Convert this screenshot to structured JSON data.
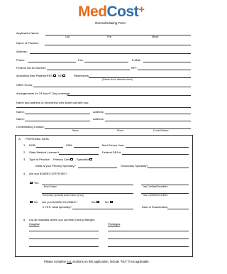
{
  "header": {
    "logo_med": "Med",
    "logo_cost": "Cost",
    "logo_plus": "+",
    "subtitle": "Recredentialing Form"
  },
  "top": {
    "applicant_name": "Applicant's Name:",
    "last": "Last",
    "first": "First",
    "middle": "Middle",
    "name_of_practice": "Name of Practice:",
    "address": "Address:",
    "phone": "Phone:",
    "fax": "Fax:",
    "email": "E-Mail:",
    "federal_tax_id": "Federal Tax ID Number:",
    "npi": "NPI:",
    "accepting": "Accepting New Patients?",
    "yes": "YES",
    "no": "NO",
    "restrictions": "Restrictions:",
    "restrictions_note": "(Please list on attached sheet)",
    "office_hours": "Office Hours:",
    "arrangements": "Arrangements for 24-hour/7 Day coverage:",
    "share_call": "Name and address or provider(s) who share call with you:",
    "name1": "Name:",
    "address1": "Address:",
    "name2": "Name:",
    "address2": "Address:",
    "credentialing_contact": "Credentialing Contact:",
    "contact_name": "Name",
    "contact_phone": "Phone",
    "contact_email": "E-mail Address"
  },
  "section_a": {
    "letter": "A.",
    "title": "PERSONAL DATA",
    "i1": "1.",
    "dob": "DOB:",
    "ssn": "SSN:",
    "med_school_year": "Med School Year:",
    "i2": "2.",
    "state_license": "State Medical License #:",
    "federal_dea": "Federal DEA #:",
    "i3": "3.",
    "type_of_practice": "Type of Practice:",
    "primary_care": "Primary Care",
    "specialist": "Specialist",
    "primary_specialty": "What is your Primary Specialty?",
    "secondary_specialty": "Secondary Specialty?",
    "i4": "4.",
    "board_certified": "Are you BOARD CERTIFIED?",
    "yes": "Yes",
    "board_name": "Board Name",
    "year_certified": "Year Certified/Recertified",
    "secondary_board": "Secondary Specialty Board Name (if any)",
    "year_certified2": "Year Certified/Recertified",
    "no": "No",
    "board_eligible": "Are you BOARD ELIGIBLE?",
    "yes2": "Yes",
    "no2": "No",
    "if_so": "If YES, what specialty?",
    "date_exam": "Date of Examination:",
    "i5": "5.",
    "list_hospitals": "List all hospitals where you currently have privileges:",
    "hospital": "Hospital",
    "privileges": "Privileges"
  },
  "footer": {
    "pre": "Please complete ",
    "all": "ALL",
    "post": " sections on this application.  Include \"N/A\" if not applicable."
  }
}
